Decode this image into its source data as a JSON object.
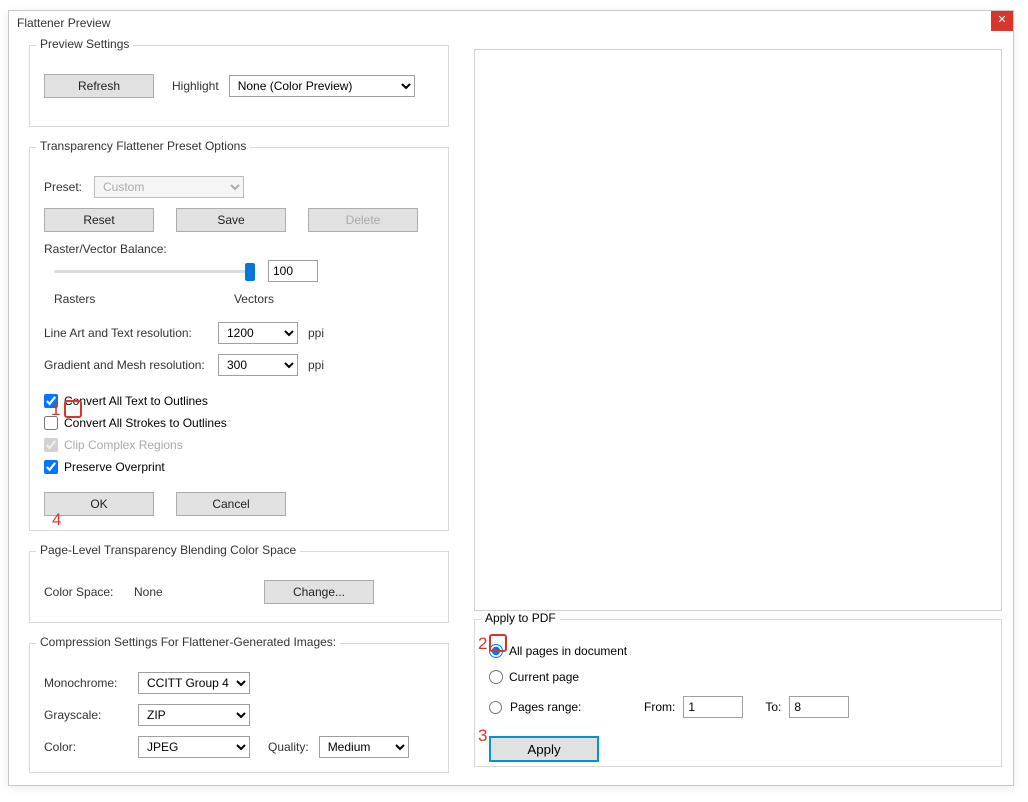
{
  "window": {
    "title": "Flattener Preview"
  },
  "preview_settings": {
    "legend": "Preview Settings",
    "refresh": "Refresh",
    "highlight_label": "Highlight",
    "highlight_value": "None (Color Preview)"
  },
  "preset_options": {
    "legend": "Transparency Flattener Preset Options",
    "preset_label": "Preset:",
    "preset_value": "Custom",
    "reset": "Reset",
    "save": "Save",
    "delete": "Delete",
    "balance_label": "Raster/Vector Balance:",
    "balance_value": "100",
    "rasters": "Rasters",
    "vectors": "Vectors",
    "line_art_label": "Line Art and Text resolution:",
    "line_art_value": "1200",
    "ppi": "ppi",
    "gradient_label": "Gradient and Mesh resolution:",
    "gradient_value": "300",
    "cb_convert_text": "Convert All Text to Outlines",
    "cb_convert_strokes": "Convert All Strokes to Outlines",
    "cb_clip_complex": "Clip Complex Regions",
    "cb_preserve_overprint": "Preserve Overprint",
    "ok": "OK",
    "cancel": "Cancel"
  },
  "color_space": {
    "legend": "Page-Level Transparency Blending Color Space",
    "label": "Color Space:",
    "value": "None",
    "change": "Change..."
  },
  "compression": {
    "legend": "Compression Settings For Flattener-Generated Images:",
    "mono_label": "Monochrome:",
    "mono_value": "CCITT Group 4",
    "gray_label": "Grayscale:",
    "gray_value": "ZIP",
    "color_label": "Color:",
    "color_value": "JPEG",
    "quality_label": "Quality:",
    "quality_value": "Medium"
  },
  "apply_pdf": {
    "legend": "Apply to PDF",
    "all_pages": "All pages in document",
    "current_page": "Current page",
    "pages_range": "Pages range:",
    "from_label": "From:",
    "from_value": "1",
    "to_label": "To:",
    "to_value": "8",
    "apply": "Apply"
  },
  "annotations": {
    "a1": "1",
    "a2": "2",
    "a3": "3",
    "a4": "4"
  }
}
